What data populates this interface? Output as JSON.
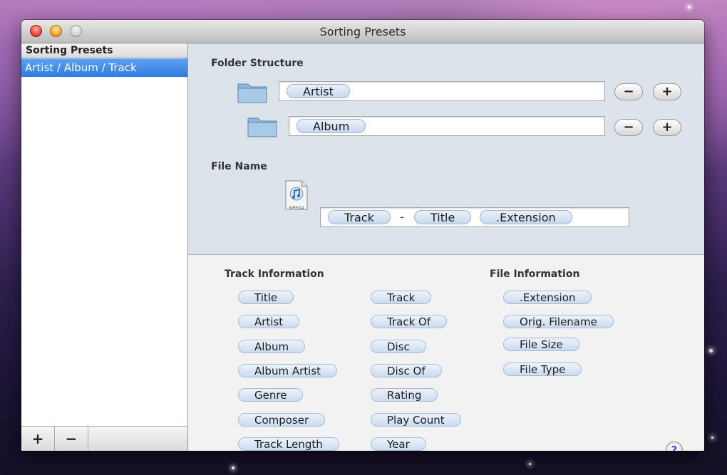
{
  "window": {
    "title": "Sorting Presets"
  },
  "sidebar": {
    "header": "Sorting Presets",
    "items": [
      {
        "label": "Artist / Album / Track",
        "selected": true
      }
    ],
    "footer": {
      "add_label": "+",
      "remove_label": "−"
    }
  },
  "folder_structure": {
    "label": "Folder Structure",
    "rows": [
      {
        "token": "Artist",
        "remove_label": "−",
        "add_label": "+"
      },
      {
        "token": "Album",
        "remove_label": "−",
        "add_label": "+"
      }
    ]
  },
  "file_name": {
    "label": "File Name",
    "icon_caption": "MPEG4",
    "tokens": [
      "Track",
      "Title",
      ".Extension"
    ],
    "separator": "-"
  },
  "track_information": {
    "label": "Track Information",
    "column1": [
      "Title",
      "Artist",
      "Album",
      "Album Artist",
      "Genre",
      "Composer",
      "Track Length"
    ],
    "column2": [
      "Track",
      "Track Of",
      "Disc",
      "Disc Of",
      "Rating",
      "Play Count",
      "Year"
    ]
  },
  "file_information": {
    "label": "File Information",
    "items": [
      ".Extension",
      "Orig. Filename",
      "File Size",
      "File Type"
    ]
  },
  "help_label": "?",
  "colors": {
    "selection": "#2e7be0",
    "token_fill": "#c9d9ef",
    "help_accent": "#6a3bb8"
  }
}
